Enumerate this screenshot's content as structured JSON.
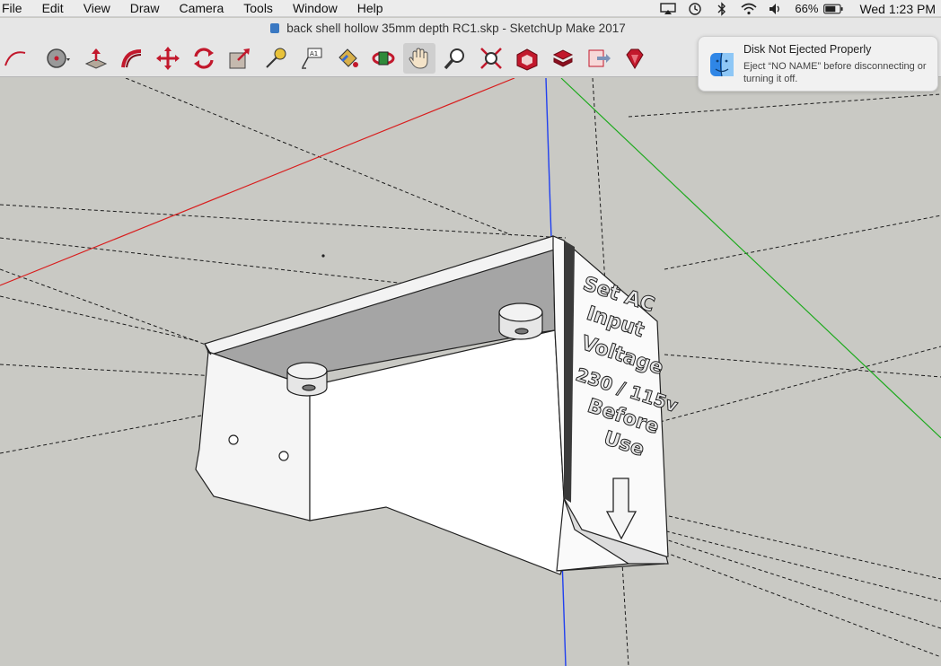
{
  "menubar": {
    "items": [
      "File",
      "Edit",
      "View",
      "Draw",
      "Camera",
      "Tools",
      "Window",
      "Help"
    ],
    "battery": "66%",
    "clock": "Wed 1:23 PM"
  },
  "window": {
    "title": "back shell hollow 35mm depth RC1.skp - SketchUp Make 2017"
  },
  "toolbar": {
    "tools": [
      "arc-tool",
      "pie-tool",
      "push-pull-tool",
      "follow-me-tool",
      "move-tool",
      "rotate-tool",
      "scale-tool",
      "tape-measure-tool",
      "text-tool",
      "paint-bucket-tool",
      "orbit-tool",
      "pan-tool",
      "zoom-tool",
      "zoom-extents-tool",
      "3d-warehouse-tool",
      "extension-warehouse-tool",
      "layout-send-tool",
      "extension-manager-tool"
    ],
    "active_tool": "pan-tool"
  },
  "model": {
    "embossed_text": [
      "Set AC",
      "Input",
      "Voltage",
      "230 / 115v",
      "Before",
      "Use"
    ]
  },
  "notification": {
    "title": "Disk Not Ejected Properly",
    "body": "Eject “NO NAME” before disconnecting or turning it off."
  },
  "colors": {
    "viewport_bg": "#c9c9c4",
    "red_axis": "#d81e1e",
    "green_axis": "#1eaa1e",
    "blue_axis": "#1f3ff0",
    "toolbar_bg": "#e6e6e6"
  }
}
